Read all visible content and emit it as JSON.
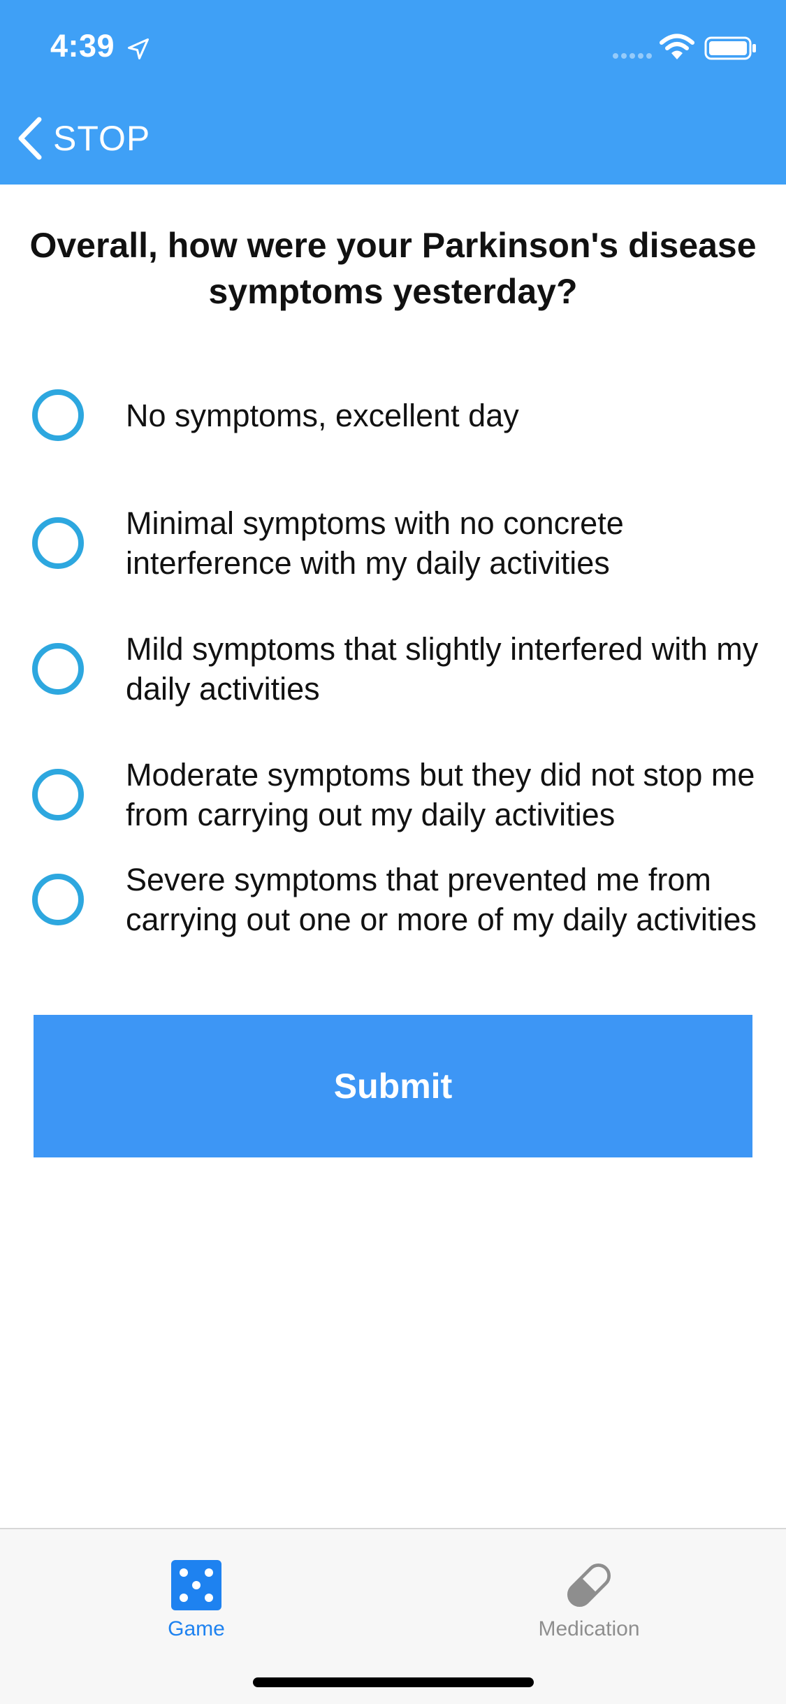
{
  "status_bar": {
    "time": "4:39",
    "icons": [
      "location-arrow-icon",
      "signal-icon",
      "wifi-icon",
      "battery-icon"
    ]
  },
  "nav": {
    "back_label": "STOP",
    "back_icon": "chevron-left-icon"
  },
  "question": "Overall, how were your Parkinson's disease symptoms yesterday?",
  "options": [
    {
      "label": "No symptoms, excellent day",
      "selected": false
    },
    {
      "label": "Minimal symptoms with no concrete interference with my daily activities",
      "selected": false
    },
    {
      "label": "Mild symptoms that slightly interfered with my daily activities",
      "selected": false
    },
    {
      "label": "Moderate symptoms but they did not stop me from carrying out my daily activities",
      "selected": false
    },
    {
      "label": "Severe symptoms that prevented me from carrying out one or more of my daily activities",
      "selected": false
    }
  ],
  "submit_label": "Submit",
  "tab_bar": {
    "tabs": [
      {
        "label": "Game",
        "icon": "dice-icon",
        "active": true
      },
      {
        "label": "Medication",
        "icon": "pill-icon",
        "active": false
      }
    ]
  },
  "colors": {
    "header": "#3fa0f6",
    "accent": "#3d96f5",
    "radio": "#2da7df",
    "tab_active": "#1e82f0",
    "tab_inactive": "#8e8e8e"
  }
}
